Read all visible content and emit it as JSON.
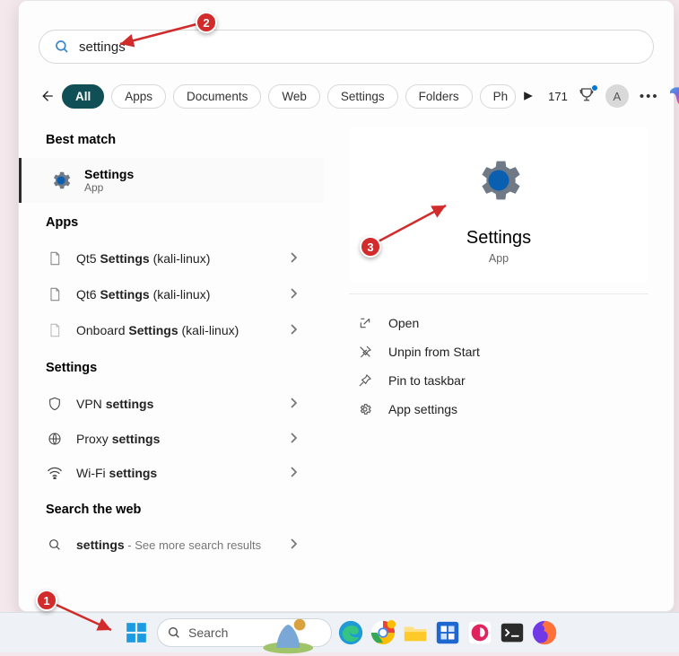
{
  "search": {
    "value": "settings"
  },
  "filters": {
    "all": "All",
    "apps": "Apps",
    "documents": "Documents",
    "web": "Web",
    "settings": "Settings",
    "folders": "Folders",
    "photos": "Ph"
  },
  "header": {
    "points": "171",
    "avatar_letter": "A"
  },
  "left": {
    "best_match_h": "Best match",
    "best": {
      "title": "Settings",
      "sub": "App"
    },
    "apps_h": "Apps",
    "apps": [
      {
        "pre": "Qt5 ",
        "bold": "Settings",
        "post": " (kali-linux)"
      },
      {
        "pre": "Qt6 ",
        "bold": "Settings",
        "post": " (kali-linux)"
      },
      {
        "pre": "Onboard ",
        "bold": "Settings",
        "post": " (kali-linux)"
      }
    ],
    "settings_h": "Settings",
    "settings": [
      {
        "pre": "VPN ",
        "bold": "settings",
        "post": ""
      },
      {
        "pre": "Proxy ",
        "bold": "settings",
        "post": ""
      },
      {
        "pre": "Wi-Fi ",
        "bold": "settings",
        "post": ""
      }
    ],
    "web_h": "Search the web",
    "web_item": {
      "bold": "settings",
      "detail": " - See more search results"
    }
  },
  "preview": {
    "title": "Settings",
    "sub": "App",
    "actions": [
      {
        "key": "open",
        "label": "Open"
      },
      {
        "key": "unpin",
        "label": "Unpin from Start"
      },
      {
        "key": "pin",
        "label": "Pin to taskbar"
      },
      {
        "key": "appsettings",
        "label": "App settings"
      }
    ]
  },
  "taskbar": {
    "search_placeholder": "Search"
  },
  "annotations": {
    "a1": "1",
    "a2": "2",
    "a3": "3"
  }
}
